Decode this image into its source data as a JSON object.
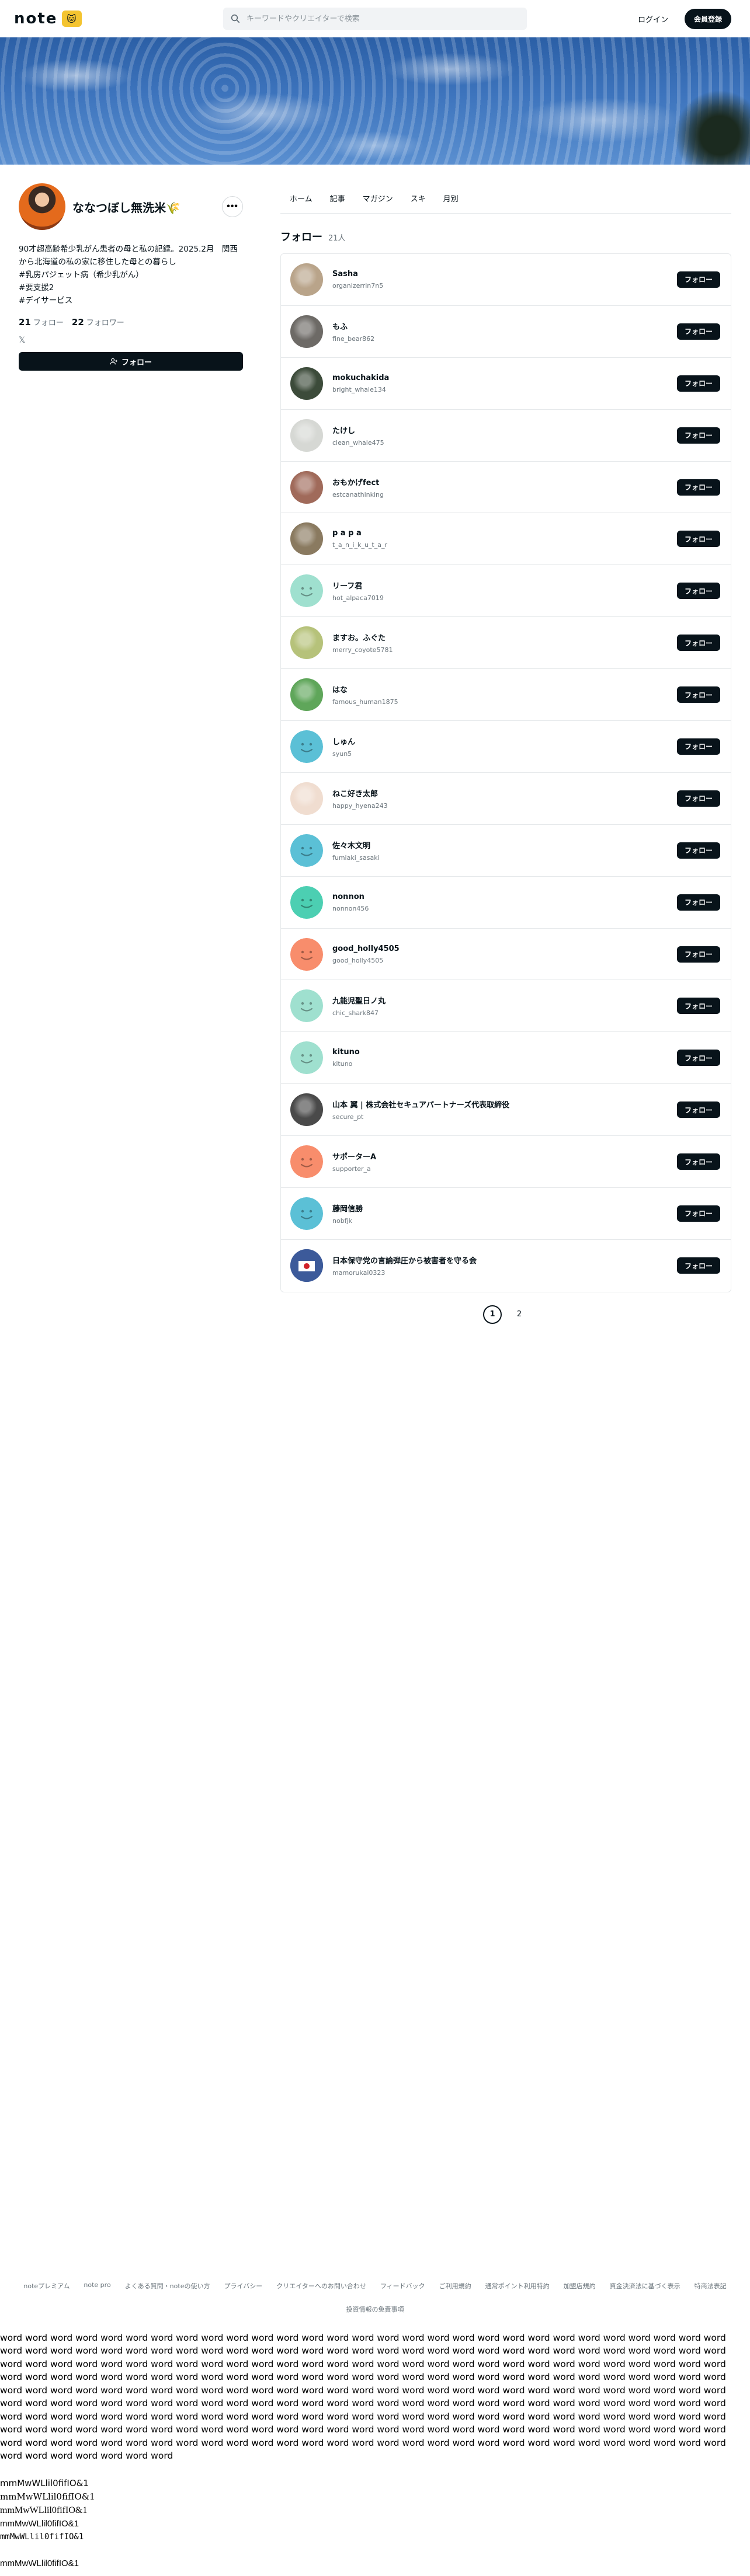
{
  "header": {
    "logo_text": "note",
    "logo_badge": "🐱",
    "search_placeholder": "キーワードやクリエイターで検索",
    "login_label": "ログイン",
    "signup_label": "会員登録"
  },
  "profile": {
    "name": "ななつぼし無洗米🌾",
    "more_label": "•••",
    "bio": "90才超高齢希少乳がん患者の母と私の記録。2025.2月　関西から北海道の私の家に移住した母との暮らし\n#乳房パジェット病（希少乳がん）\n#要支援2\n#デイサービス",
    "following_count": "21",
    "following_label": "フォロー",
    "followers_count": "22",
    "followers_label": "フォロワー",
    "x_icon": "𝕏",
    "follow_label": "フォロー"
  },
  "tabs": [
    {
      "label": "ホーム"
    },
    {
      "label": "記事"
    },
    {
      "label": "マガジン"
    },
    {
      "label": "スキ"
    },
    {
      "label": "月別"
    }
  ],
  "list": {
    "title": "フォロー",
    "count": "21人",
    "follow_button": "フォロー",
    "items": [
      {
        "name": "Sasha",
        "id": "organizerrin7n5",
        "avatar": "photo",
        "color": "#b9a48a"
      },
      {
        "name": "もふ",
        "id": "fine_bear862",
        "avatar": "photo",
        "color": "#6d6a66"
      },
      {
        "name": "mokuchakida",
        "id": "bright_whale134",
        "avatar": "photo",
        "color": "#3c4b3a"
      },
      {
        "name": "たけし",
        "id": "clean_whale475",
        "avatar": "photo",
        "color": "#d6d8d4"
      },
      {
        "name": "おもかげfect",
        "id": "estcanathinking",
        "avatar": "photo",
        "color": "#a06a5a"
      },
      {
        "name": "p a p a",
        "id": "t_a_n_i_k_u_t_a_r",
        "avatar": "photo",
        "color": "#8a7a60"
      },
      {
        "name": "リーフ君",
        "id": "hot_alpaca7019",
        "avatar": "smile",
        "color": "#9fe0cf"
      },
      {
        "name": "ますお。ふぐた",
        "id": "merry_coyote5781",
        "avatar": "photo",
        "color": "#b6c27a"
      },
      {
        "name": "はな",
        "id": "famous_human1875",
        "avatar": "photo",
        "color": "#5fa65a"
      },
      {
        "name": "しゅん",
        "id": "syun5",
        "avatar": "smile",
        "color": "#5bc0d6"
      },
      {
        "name": "ねこ好き太郎",
        "id": "happy_hyena243",
        "avatar": "photo",
        "color": "#f0ddd0"
      },
      {
        "name": "佐々木文明",
        "id": "fumiaki_sasaki",
        "avatar": "smile",
        "color": "#5bc0d6"
      },
      {
        "name": "nonnon",
        "id": "nonnon456",
        "avatar": "smile",
        "color": "#4ccfb2"
      },
      {
        "name": "good_holly4505",
        "id": "good_holly4505",
        "avatar": "smile",
        "color": "#f88d6c"
      },
      {
        "name": "九能児聖日ノ丸",
        "id": "chic_shark847",
        "avatar": "smile",
        "color": "#9fe0cf"
      },
      {
        "name": "kituno",
        "id": "kituno",
        "avatar": "smile",
        "color": "#9fe0cf"
      },
      {
        "name": "山本 翼 | 株式会社セキュアパートナーズ代表取締役",
        "id": "secure_pt",
        "avatar": "photo",
        "color": "#4a4a4a"
      },
      {
        "name": "サポーターA",
        "id": "supporter_a",
        "avatar": "smile",
        "color": "#f88d6c"
      },
      {
        "name": "藤岡信勝",
        "id": "nobfjk",
        "avatar": "smile",
        "color": "#5bc0d6"
      },
      {
        "name": "日本保守党の言論弾圧から被害者を守る会",
        "id": "mamorukai0323",
        "avatar": "flag",
        "color": "#3c5a9a"
      }
    ]
  },
  "pagination": {
    "pages": [
      "1",
      "2"
    ],
    "current": "1"
  },
  "footer": {
    "links": [
      "noteプレミアム",
      "note pro",
      "よくある質問・noteの使い方",
      "プライバシー",
      "クリエイターへのお問い合わせ",
      "フィードバック",
      "ご利用規約",
      "通常ポイント利用特約",
      "加盟店規約",
      "資金決済法に基づく表示",
      "特商法表記"
    ],
    "sub_link": "投資情報の免責事項"
  },
  "filler": {
    "word": "word",
    "word_count": 268,
    "lines": [
      "mmMwWLlil0fifIO&1",
      "mmMwWLlil0fifIO&1",
      "mmMwWLlil0fifIO&1",
      "mmMwWLlil0fifIO&1",
      "mmMwWLlil0fifIO&1",
      "mmMwWLlil0fifIO&1"
    ]
  },
  "colors": {
    "brand_dark": "#08131a",
    "muted": "#6b757c",
    "border": "#e6e9eb"
  }
}
